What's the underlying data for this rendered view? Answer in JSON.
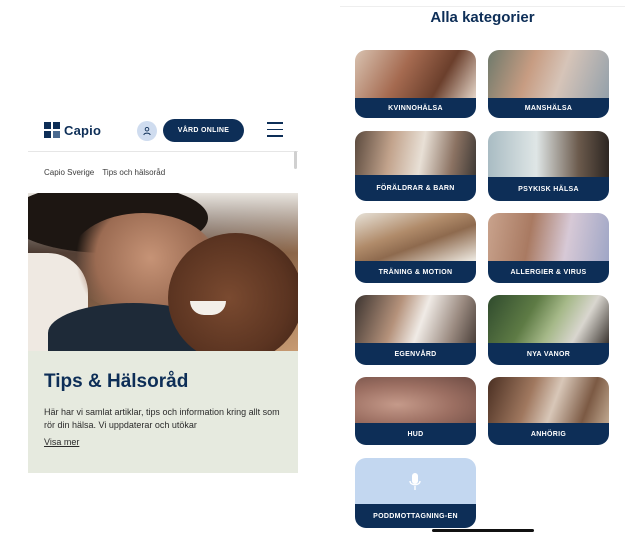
{
  "left_screen": {
    "logo_text": "Capio",
    "vard_online_label": "VÅRD ONLINE",
    "breadcrumb": [
      "Capio Sverige",
      "Tips och hälsoråd"
    ],
    "title": "Tips & Hälsoråd",
    "description": "Här har vi samlat artiklar, tips och information kring allt som rör din hälsa. Vi uppdaterar och utökar",
    "visa_mer_label": "Visa mer"
  },
  "right_screen": {
    "title": "Alla kategorier",
    "categories": [
      {
        "label": "KVINNOHÄLSA"
      },
      {
        "label": "MANSHÄLSA"
      },
      {
        "label": "FÖRÄLDRAR & BARN"
      },
      {
        "label": "PSYKISK HÄLSA"
      },
      {
        "label": "TRÄNING & MOTION"
      },
      {
        "label": "ALLERGIER & VIRUS"
      },
      {
        "label": "EGENVÅRD"
      },
      {
        "label": "NYA VANOR"
      },
      {
        "label": "HUD"
      },
      {
        "label": "ANHÖRIG"
      },
      {
        "label": "PODDMOTTAGNING-EN",
        "icon": "microphone-icon"
      }
    ]
  },
  "colors": {
    "brand_navy": "#0d2e57",
    "content_bg": "#e6eadf",
    "podd_bg": "#c3d7f0"
  }
}
